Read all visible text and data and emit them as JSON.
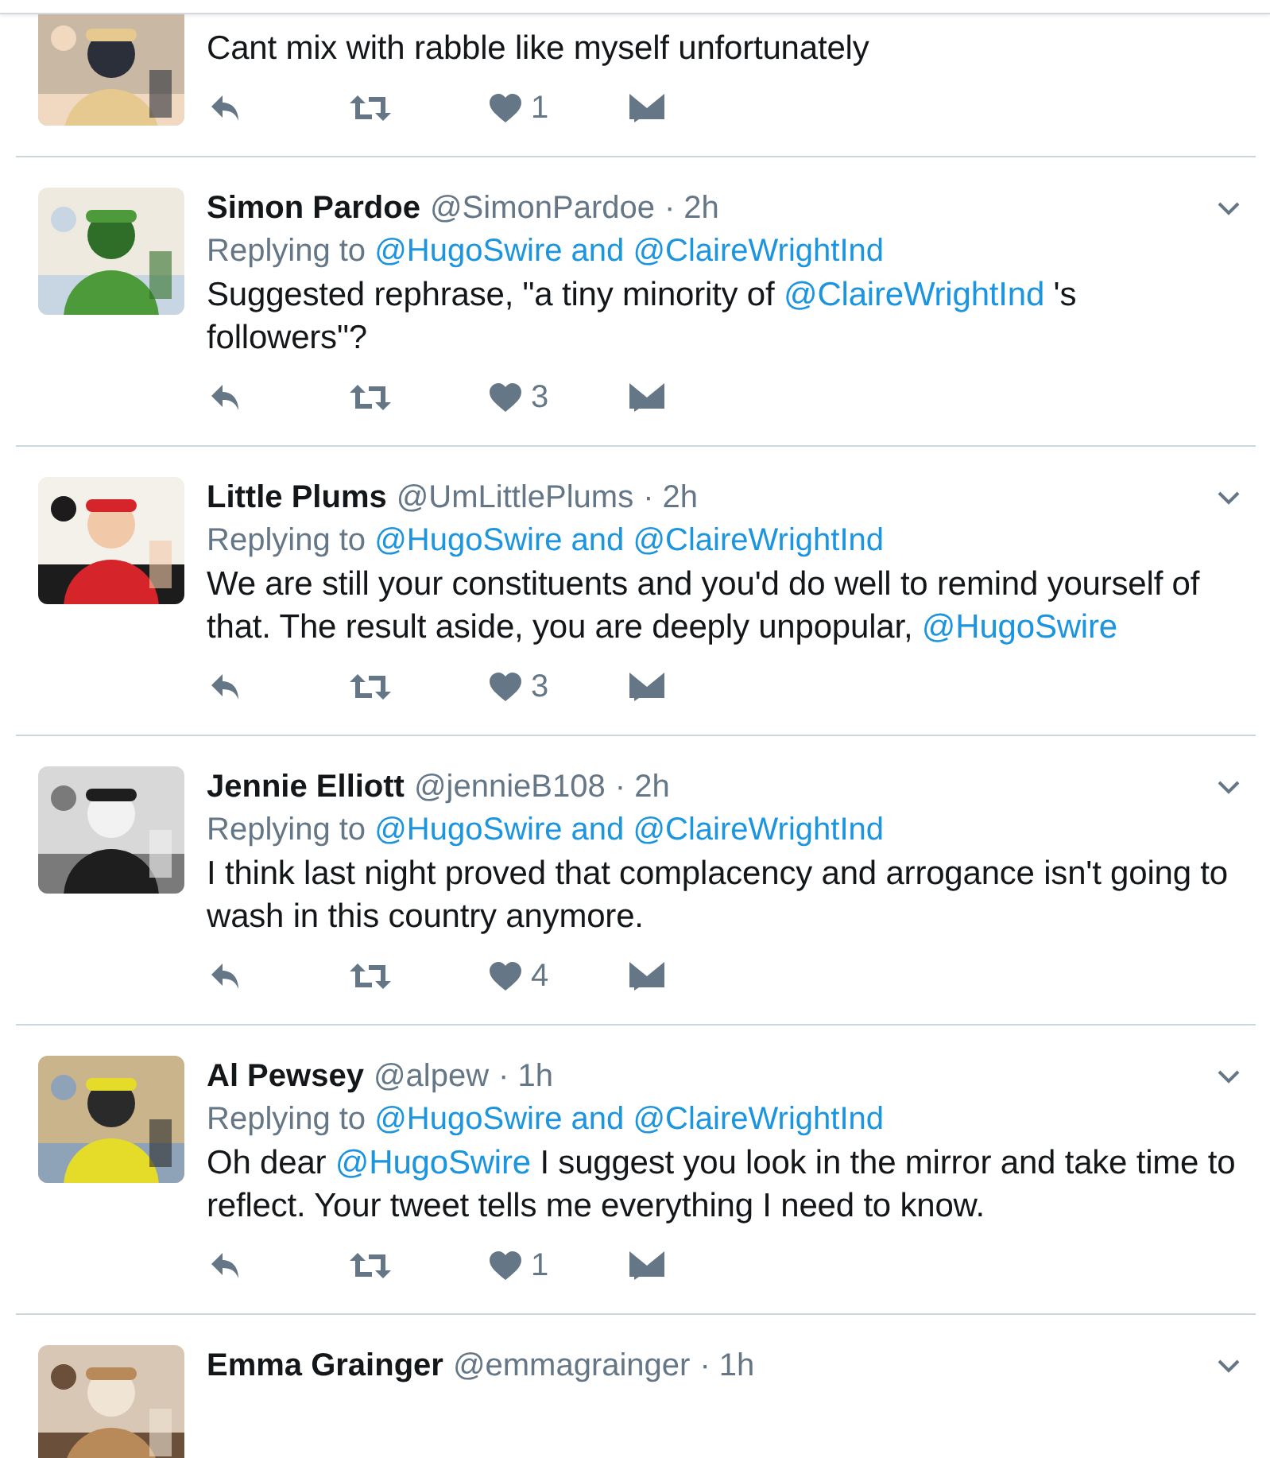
{
  "tweets": [
    {
      "body": [
        {
          "kind": "text",
          "text": "Cant mix with rabble like myself unfortunately"
        }
      ],
      "likes": "1",
      "avatar": {
        "kind": "picture"
      }
    },
    {
      "name": "Simon Pardoe",
      "handle": "@SimonPardoe",
      "time": "· 2h",
      "reply_label": "Replying to",
      "reply_to": "@HugoSwire and @ClaireWrightInd",
      "body": [
        {
          "kind": "text",
          "text": "Suggested rephrase, \"a tiny minority of "
        },
        {
          "kind": "mention",
          "text": "@ClaireWrightInd"
        },
        {
          "kind": "text",
          "text": " 's followers\"?"
        }
      ],
      "likes": "3",
      "avatar": {
        "kind": "picture"
      }
    },
    {
      "name": "Little Plums",
      "handle": "@UmLittlePlums",
      "time": "· 2h",
      "reply_label": "Replying to",
      "reply_to": "@HugoSwire and @ClaireWrightInd",
      "body": [
        {
          "kind": "text",
          "text": "We are still your constituents and you'd do well to remind yourself of that. The result aside, you are deeply unpopular, "
        },
        {
          "kind": "mention",
          "text": "@HugoSwire"
        }
      ],
      "likes": "3",
      "avatar": {
        "kind": "picture"
      }
    },
    {
      "name": "Jennie Elliott",
      "handle": "@jennieB108",
      "time": "· 2h",
      "reply_label": "Replying to",
      "reply_to": "@HugoSwire and @ClaireWrightInd",
      "body": [
        {
          "kind": "text",
          "text": "I think last night proved that complacency and arrogance isn't going to wash in this country anymore."
        }
      ],
      "likes": "4",
      "avatar": {
        "kind": "picture"
      }
    },
    {
      "name": "Al Pewsey",
      "handle": "@alpew",
      "time": "· 1h",
      "reply_label": "Replying to",
      "reply_to": "@HugoSwire and @ClaireWrightInd",
      "body": [
        {
          "kind": "text",
          "text": "Oh dear "
        },
        {
          "kind": "mention",
          "text": "@HugoSwire"
        },
        {
          "kind": "text",
          "text": " I suggest you look in the mirror and take time to reflect. Your tweet tells me everything I need to know."
        }
      ],
      "likes": "1",
      "avatar": {
        "kind": "picture"
      }
    },
    {
      "name": "Emma Grainger",
      "handle": "@emmagrainger",
      "time": "· 1h",
      "avatar": {
        "kind": "picture"
      }
    }
  ]
}
